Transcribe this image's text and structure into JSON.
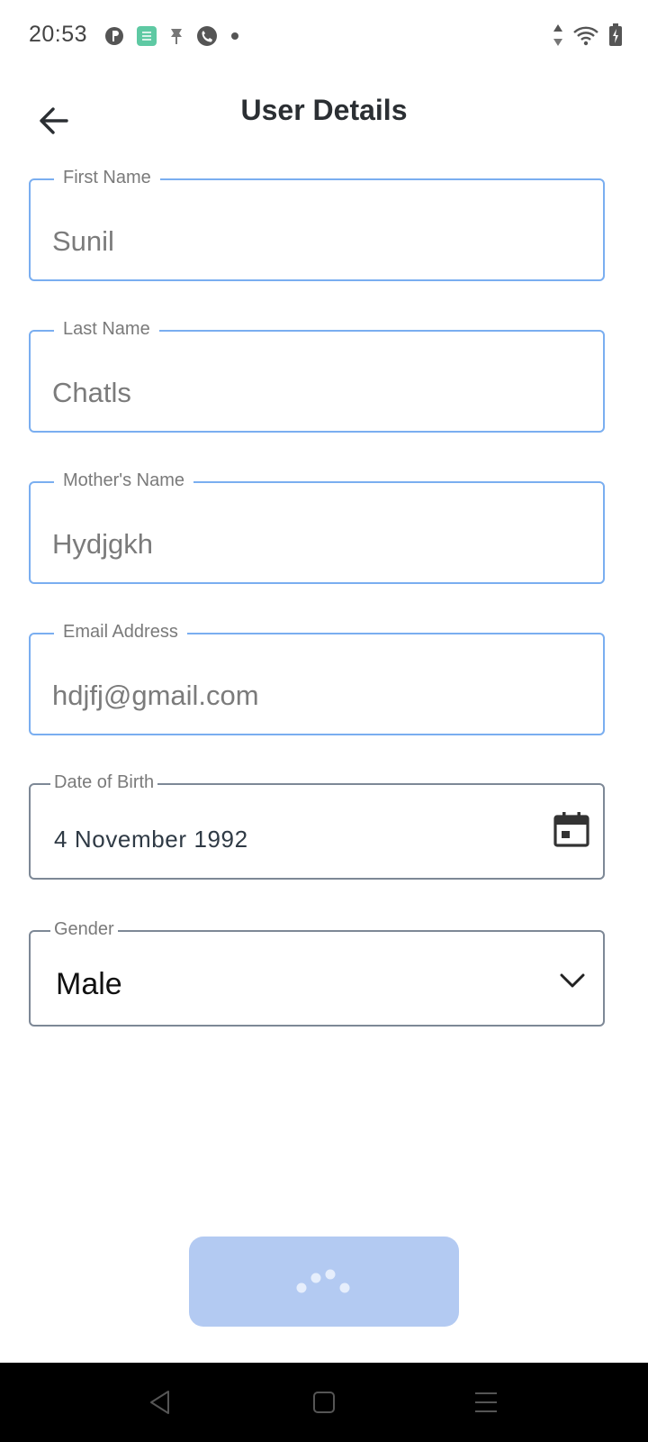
{
  "status_bar": {
    "time": "20:53",
    "left_icons": [
      "notification-app-icon",
      "notification-chip-icon",
      "notification-pin-icon",
      "phone-call-icon",
      "more-dot-icon"
    ],
    "right_icons": [
      "data-arrows-icon",
      "wifi-icon",
      "battery-charging-icon"
    ]
  },
  "app_bar": {
    "title": "User Details",
    "back_icon": "arrow-back-icon"
  },
  "form": {
    "first_name": {
      "label": "First Name",
      "value": "Sunil"
    },
    "last_name": {
      "label": "Last Name",
      "value": "Chatls"
    },
    "mother_name": {
      "label": "Mother's Name",
      "value": "Hydjgkh"
    },
    "email": {
      "label": "Email Address",
      "value": "hdjfj@gmail.com"
    },
    "dob": {
      "label": "Date of Birth",
      "value": "4 November 1992",
      "icon": "calendar-icon"
    },
    "gender": {
      "label": "Gender",
      "value": "Male",
      "icon": "chevron-down-icon"
    }
  },
  "submit": {
    "state": "loading",
    "icon": "loading-dots-icon"
  },
  "nav_bar": {
    "back": "nav-back-icon",
    "home": "nav-home-icon",
    "menu": "nav-menu-icon"
  },
  "colors": {
    "accent_border": "#7aaef0",
    "neutral_border": "#7d8896",
    "submit_bg": "#b3caf2",
    "nav_bg": "#000000"
  }
}
